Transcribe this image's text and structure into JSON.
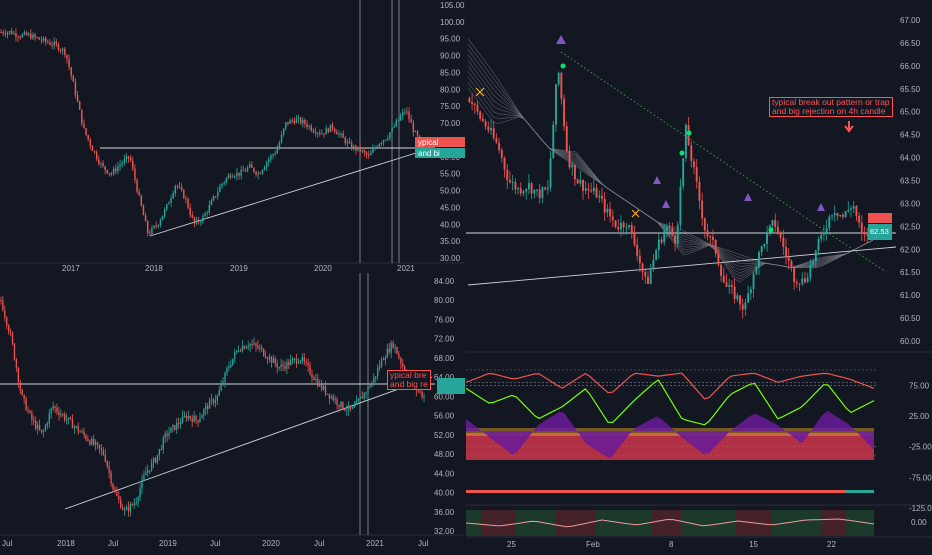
{
  "colors": {
    "background": "#131722",
    "up": "#26a69a",
    "down": "#ef5350",
    "axis_text": "#b2b5be",
    "grid_line": "#2a2e39",
    "trend_line": "#d1d4dc",
    "annotation": "#ff5252",
    "price_badge": "#26a69a"
  },
  "top_left": {
    "y_ticks": [
      "105.00",
      "100.00",
      "95.00",
      "90.00",
      "85.00",
      "80.00",
      "75.00",
      "70.00",
      "65.00",
      "60.00",
      "55.00",
      "50.00",
      "45.00",
      "40.00",
      "35.00",
      "30.00"
    ],
    "x_ticks": [
      "2017",
      "2018",
      "2019",
      "2020",
      "2021"
    ]
  },
  "bottom_left": {
    "y_ticks": [
      "84.00",
      "80.00",
      "76.00",
      "72.00",
      "68.00",
      "64.00",
      "60.00",
      "56.00",
      "52.00",
      "48.00",
      "44.00",
      "40.00",
      "36.00",
      "32.00"
    ],
    "x_ticks": [
      "Jul",
      "2018",
      "Jul",
      "2019",
      "Jul",
      "2020",
      "Jul",
      "2021",
      "Jul"
    ],
    "annotation": "ypical bre\nand big re"
  },
  "right_main": {
    "y_ticks": [
      "67.00",
      "66.50",
      "66.00",
      "65.50",
      "65.00",
      "64.50",
      "64.00",
      "63.50",
      "63.00",
      "62.50",
      "62.00",
      "61.50",
      "61.00",
      "60.50",
      "60.00"
    ],
    "x_ticks": [
      "25",
      "Feb",
      "8",
      "15",
      "22"
    ],
    "annotation": "typical break out pattern or trap\nand big rejection on 4h candle",
    "last_price": "62.53"
  },
  "right_oscillator": {
    "y_ticks": [
      "75.00",
      "25.00",
      "-25.00",
      "-75.00",
      "-125.00"
    ]
  },
  "right_bottom": {
    "y_ticks": [
      "0.00"
    ]
  },
  "chart_data": [
    {
      "type": "candlestick",
      "pane": "weekly, 2017–2021",
      "ylim": [
        30,
        105
      ],
      "x": [
        "2016-07",
        "2016-10",
        "2017-01",
        "2017-02",
        "2017-04",
        "2017-06",
        "2017-08",
        "2017-10",
        "2017-12",
        "2018-01",
        "2018-03",
        "2018-05",
        "2018-07",
        "2018-09",
        "2018-11",
        "2019-01",
        "2019-03",
        "2019-05",
        "2019-07",
        "2019-09",
        "2019-11",
        "2020-01",
        "2020-03",
        "2020-05",
        "2020-07",
        "2020-09",
        "2020-11",
        "2021-01",
        "2021-02"
      ],
      "close": [
        97,
        97,
        96,
        95,
        80,
        68,
        57,
        55,
        60,
        37,
        45,
        50,
        40,
        42,
        50,
        55,
        55,
        57,
        59,
        61,
        60,
        69,
        72,
        68,
        67,
        62,
        64,
        70,
        63
      ]
    },
    {
      "type": "candlestick",
      "pane": "daily, 2017–2021",
      "ylim": [
        32,
        84
      ],
      "x": [
        "2017-07",
        "2017-10",
        "2018-01",
        "2018-04",
        "2018-07",
        "2018-10",
        "2019-01",
        "2019-04",
        "2019-07",
        "2019-10",
        "2020-01",
        "2020-04",
        "2020-07",
        "2020-10",
        "2021-01",
        "2021-02"
      ],
      "close": [
        77,
        55,
        50,
        38,
        45,
        53,
        55,
        60,
        65,
        69,
        66,
        62,
        58,
        61,
        70,
        60
      ]
    },
    {
      "type": "candlestick",
      "pane": "4h, Jan–Feb 2021",
      "ylim": [
        60,
        67
      ],
      "x": [
        "2021-01-19",
        "2021-01-22",
        "2021-01-25",
        "2021-01-27",
        "2021-01-29",
        "2021-02-01",
        "2021-02-03",
        "2021-02-05",
        "2021-02-08",
        "2021-02-10",
        "2021-02-12",
        "2021-02-15",
        "2021-02-17",
        "2021-02-19",
        "2021-02-22",
        "2021-02-24"
      ],
      "close": [
        65.0,
        64.0,
        63.4,
        65.0,
        63.5,
        62.5,
        61.4,
        62.5,
        64.6,
        62.4,
        60.6,
        61.6,
        62.6,
        61.1,
        62.3,
        62.53
      ]
    }
  ]
}
